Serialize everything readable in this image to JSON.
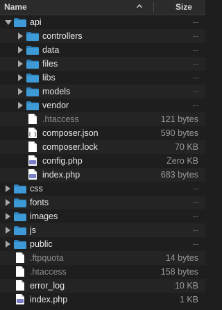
{
  "header": {
    "name_label": "Name",
    "size_label": "Size",
    "sort_icon": "chevron-up-icon"
  },
  "colors": {
    "folder": "#3e9ad6",
    "folder_dark": "#2f7fb8",
    "php_badge": "#7b7fc4",
    "document": "#ffffff"
  },
  "rows": [
    {
      "name": "api",
      "size": "--",
      "kind": "folder",
      "level": 0,
      "expanded": true,
      "dim": false
    },
    {
      "name": "controllers",
      "size": "--",
      "kind": "folder",
      "level": 1,
      "expanded": false,
      "dim": false
    },
    {
      "name": "data",
      "size": "--",
      "kind": "folder",
      "level": 1,
      "expanded": false,
      "dim": false
    },
    {
      "name": "files",
      "size": "--",
      "kind": "folder",
      "level": 1,
      "expanded": false,
      "dim": false
    },
    {
      "name": "libs",
      "size": "--",
      "kind": "folder",
      "level": 1,
      "expanded": false,
      "dim": false
    },
    {
      "name": "models",
      "size": "--",
      "kind": "folder",
      "level": 1,
      "expanded": false,
      "dim": false
    },
    {
      "name": "vendor",
      "size": "--",
      "kind": "folder",
      "level": 1,
      "expanded": false,
      "dim": false
    },
    {
      "name": ".htaccess",
      "size": "121 bytes",
      "kind": "file",
      "level": 1,
      "dim": true
    },
    {
      "name": "composer.json",
      "size": "590 bytes",
      "kind": "json",
      "level": 1,
      "dim": false
    },
    {
      "name": "composer.lock",
      "size": "70 KB",
      "kind": "file",
      "level": 1,
      "dim": false
    },
    {
      "name": "config.php",
      "size": "Zero KB",
      "kind": "php",
      "level": 1,
      "dim": false
    },
    {
      "name": "index.php",
      "size": "683 bytes",
      "kind": "php",
      "level": 1,
      "dim": false
    },
    {
      "name": "css",
      "size": "--",
      "kind": "folder",
      "level": 0,
      "expanded": false,
      "dim": false
    },
    {
      "name": "fonts",
      "size": "--",
      "kind": "folder",
      "level": 0,
      "expanded": false,
      "dim": false
    },
    {
      "name": "images",
      "size": "--",
      "kind": "folder",
      "level": 0,
      "expanded": false,
      "dim": false
    },
    {
      "name": "js",
      "size": "--",
      "kind": "folder",
      "level": 0,
      "expanded": false,
      "dim": false
    },
    {
      "name": "public",
      "size": "--",
      "kind": "folder",
      "level": 0,
      "expanded": false,
      "dim": false
    },
    {
      "name": ".ftpquota",
      "size": "14 bytes",
      "kind": "file",
      "level": 0,
      "dim": true
    },
    {
      "name": ".htaccess",
      "size": "158 bytes",
      "kind": "file",
      "level": 0,
      "dim": true
    },
    {
      "name": "error_log",
      "size": "10 KB",
      "kind": "file",
      "level": 0,
      "dim": false
    },
    {
      "name": "index.php",
      "size": "1 KB",
      "kind": "php",
      "level": 0,
      "dim": false
    }
  ]
}
